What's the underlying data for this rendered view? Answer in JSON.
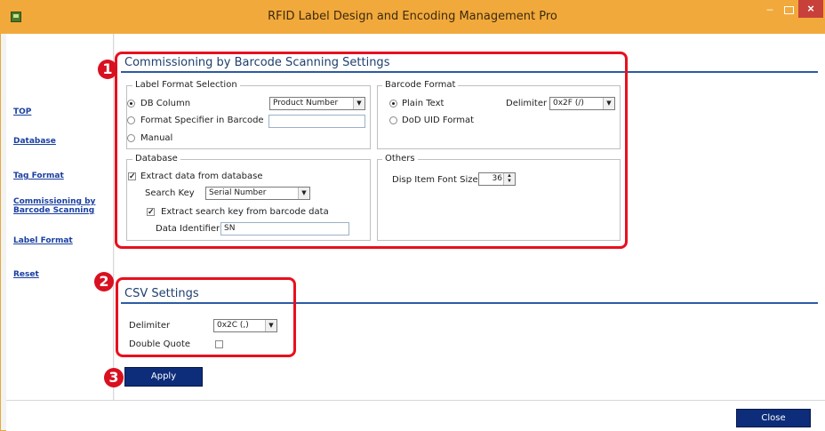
{
  "window": {
    "title": "RFID Label Design and Encoding Management Pro",
    "minimize_glyph": "–",
    "close_glyph": "×"
  },
  "sidebar": {
    "items": [
      {
        "label": "TOP"
      },
      {
        "label": "Database"
      },
      {
        "label": "Tag Format"
      },
      {
        "label": "Commissioning by Barcode Scanning"
      },
      {
        "label": "Label Format"
      },
      {
        "label": "Reset"
      }
    ]
  },
  "commissioning": {
    "title": "Commissioning by Barcode Scanning Settings",
    "label_format_selection": {
      "title": "Label Format Selection",
      "options": [
        "DB Column",
        "Format Specifier in Barcode",
        "Manual"
      ],
      "selected_index": 0,
      "db_column_value": "Product Number",
      "format_specifier_value": ""
    },
    "barcode_format": {
      "title": "Barcode Format",
      "options": [
        "Plain Text",
        "DoD UID Format"
      ],
      "selected_index": 0,
      "delimiter_label": "Delimiter",
      "delimiter_value": "0x2F (/)"
    },
    "database": {
      "title": "Database",
      "extract_label": "Extract data from database",
      "extract_checked": true,
      "search_key_label": "Search Key",
      "search_key_value": "Serial Number",
      "extract_key_label": "Extract search key from barcode data",
      "extract_key_checked": true,
      "data_identifier_label": "Data Identifier",
      "data_identifier_value": "SN"
    },
    "others": {
      "title": "Others",
      "font_size_label": "Disp Item Font Size",
      "font_size_value": "36"
    }
  },
  "csv": {
    "title": "CSV Settings",
    "delimiter_label": "Delimiter",
    "delimiter_value": "0x2C (,)",
    "double_quote_label": "Double Quote",
    "double_quote_checked": false
  },
  "buttons": {
    "apply": "Apply",
    "close": "Close"
  },
  "callouts": [
    "1",
    "2",
    "3"
  ],
  "colors": {
    "titlebar": "#f2a93b",
    "accent_blue": "#0d2d7a",
    "callout_red": "#e8101e",
    "link_blue": "#1a3fa0"
  }
}
